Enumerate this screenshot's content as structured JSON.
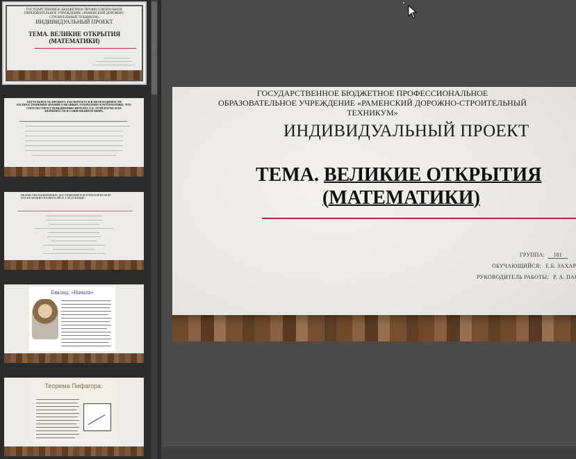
{
  "thumbnails": [
    {
      "header": "ГОСУДАРСТВЕННОЕ БЮДЖЕТНОЕ ПРОФЕССИОНАЛЬНОЕ ОБРАЗОВАТЕЛЬНОЕ УЧРЕЖДЕНИЕ «РАМЕНСКИЙ ДОРОЖНО-СТРОИТЕЛЬНЫЙ ТЕХНИКУМ»",
      "project": "ИНДИВИДУАЛЬНЫЙ ПРОЕКТ",
      "theme_line1": "ТЕМА. ВЕЛИКИЕ ОТКРЫТИЯ",
      "theme_line2": "(МАТЕМАТИКИ)"
    },
    {
      "heading": "АКТУАЛЬНОСТЬ ПРОЕКТА ЗАКЛЮЧАЕТСЯ В НЕОБХОДИМОСТИ РАСПРОСТРАНЕНИЯ ЗНАНИЙ О ВЕЛИКИХ ОТКРЫТИЯХ В МАТЕМАТИКЕ, ЧТО СПОСОБСТВУЕТ ПОВЫШЕНИЮ ИНТЕРЕСА К ЭТОЙ НАУКЕ И ЕЁ ЗНАЧИМОСТИ В СОВРЕМЕННОМ МИРЕ."
    },
    {
      "heading": "ВКАЧЕСТВЕ ВАЖНЕЙШИХ ДОСТИЖЕНИЙ В МАТЕМАТИЧЕСКОЙ НАУКЕ МОЖНО НАЗВАТЬ НЕСЕ СЛЕДУЮЩИЕ:"
    },
    {
      "title": "Евклид. «Начала»"
    },
    {
      "title": "Теорема Пифагора."
    }
  ],
  "slide": {
    "header_line1": "ГОСУДАРСТВЕННОЕ БЮДЖЕТНОЕ ПРОФЕССИОНАЛЬНОЕ",
    "header_line2": "ОБРАЗОВАТЕЛЬНОЕ УЧРЕЖДЕНИЕ «РАМЕНСКИЙ ДОРОЖНО-СТРОИТЕЛЬНЫЙ",
    "header_line3": "ТЕХНИКУМ»",
    "project": "ИНДИВИДУАЛЬНЫЙ ПРОЕКТ",
    "theme_prefix": "ТЕМА.",
    "theme_line1": "ВЕЛИКИЕ ОТКРЫТИЯ",
    "theme_line2": "(МАТЕМАТИКИ)",
    "group_label": "ГРУППА:",
    "group_value": "181",
    "student_label": "ОБУЧАЮЩИЙСЯ:",
    "student_value": "Е.Б. ЗАХАРОВ",
    "supervisor_label": "РУКОВОДИТЕЛЬ РАБОТЫ:",
    "supervisor_value": "Р. А. ПАРМОН"
  }
}
